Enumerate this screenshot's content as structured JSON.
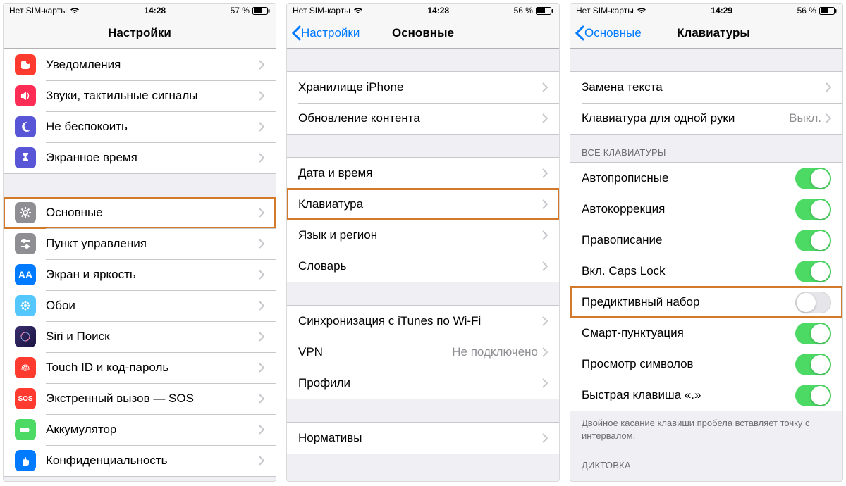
{
  "screens": [
    {
      "status": {
        "carrier": "Нет SIM-карты",
        "time": "14:28",
        "battery": "57 %"
      },
      "nav": {
        "title": "Настройки",
        "back": null
      },
      "groups": [
        {
          "rows": [
            {
              "label": "Уведомления",
              "icon_bg": "#ff3b30",
              "glyph": "notif"
            },
            {
              "label": "Звуки, тактильные сигналы",
              "icon_bg": "#ff2d55",
              "glyph": "sound"
            },
            {
              "label": "Не беспокоить",
              "icon_bg": "#5856d6",
              "glyph": "moon"
            },
            {
              "label": "Экранное время",
              "icon_bg": "#5856d6",
              "glyph": "hourglass"
            }
          ]
        },
        {
          "rows": [
            {
              "label": "Основные",
              "icon_bg": "#8e8e93",
              "glyph": "gear",
              "highlight": true
            },
            {
              "label": "Пункт управления",
              "icon_bg": "#8e8e93",
              "glyph": "sliders"
            },
            {
              "label": "Экран и яркость",
              "icon_bg": "#007aff",
              "glyph": "AA"
            },
            {
              "label": "Обои",
              "icon_bg": "#54c7fc",
              "glyph": "flower"
            },
            {
              "label": "Siri и Поиск",
              "icon_bg": "#212145",
              "glyph": "siri"
            },
            {
              "label": "Touch ID и код-пароль",
              "icon_bg": "#ff3b30",
              "glyph": "fingerprint"
            },
            {
              "label": "Экстренный вызов — SOS",
              "icon_bg": "#ff3b30",
              "glyph": "SOS"
            },
            {
              "label": "Аккумулятор",
              "icon_bg": "#4cd964",
              "glyph": "battery"
            },
            {
              "label": "Конфиденциальность",
              "icon_bg": "#007aff",
              "glyph": "hand"
            }
          ]
        }
      ]
    },
    {
      "status": {
        "carrier": "Нет SIM-карты",
        "time": "14:28",
        "battery": "56 %"
      },
      "nav": {
        "title": "Основные",
        "back": "Настройки"
      },
      "groups": [
        {
          "rows": [
            {
              "label": "Хранилище iPhone"
            },
            {
              "label": "Обновление контента"
            }
          ]
        },
        {
          "rows": [
            {
              "label": "Дата и время"
            },
            {
              "label": "Клавиатура",
              "highlight": true
            },
            {
              "label": "Язык и регион"
            },
            {
              "label": "Словарь"
            }
          ]
        },
        {
          "rows": [
            {
              "label": "Синхронизация с iTunes по Wi-Fi"
            },
            {
              "label": "VPN",
              "value": "Не подключено"
            },
            {
              "label": "Профили"
            }
          ]
        },
        {
          "rows": [
            {
              "label": "Нормативы"
            }
          ]
        }
      ]
    },
    {
      "status": {
        "carrier": "Нет SIM-карты",
        "time": "14:29",
        "battery": "56 %"
      },
      "nav": {
        "title": "Клавиатуры",
        "back": "Основные"
      },
      "groups": [
        {
          "rows": [
            {
              "label": "Замена текста",
              "chevron": true
            },
            {
              "label": "Клавиатура для одной руки",
              "value": "Выкл.",
              "chevron": true
            }
          ]
        },
        {
          "header": "ВСЕ КЛАВИАТУРЫ",
          "rows": [
            {
              "label": "Автопрописные",
              "toggle": true
            },
            {
              "label": "Автокоррекция",
              "toggle": true
            },
            {
              "label": "Правописание",
              "toggle": true
            },
            {
              "label": "Вкл. Caps Lock",
              "toggle": true
            },
            {
              "label": "Предиктивный набор",
              "toggle": false,
              "highlight": true
            },
            {
              "label": "Смарт-пунктуация",
              "toggle": true
            },
            {
              "label": "Просмотр символов",
              "toggle": true
            },
            {
              "label": "Быстрая клавиша «.»",
              "toggle": true
            }
          ],
          "footer": "Двойное касание клавиши пробела вставляет точку с интервалом."
        },
        {
          "header": "ДИКТОВКА",
          "rows": []
        }
      ]
    }
  ]
}
